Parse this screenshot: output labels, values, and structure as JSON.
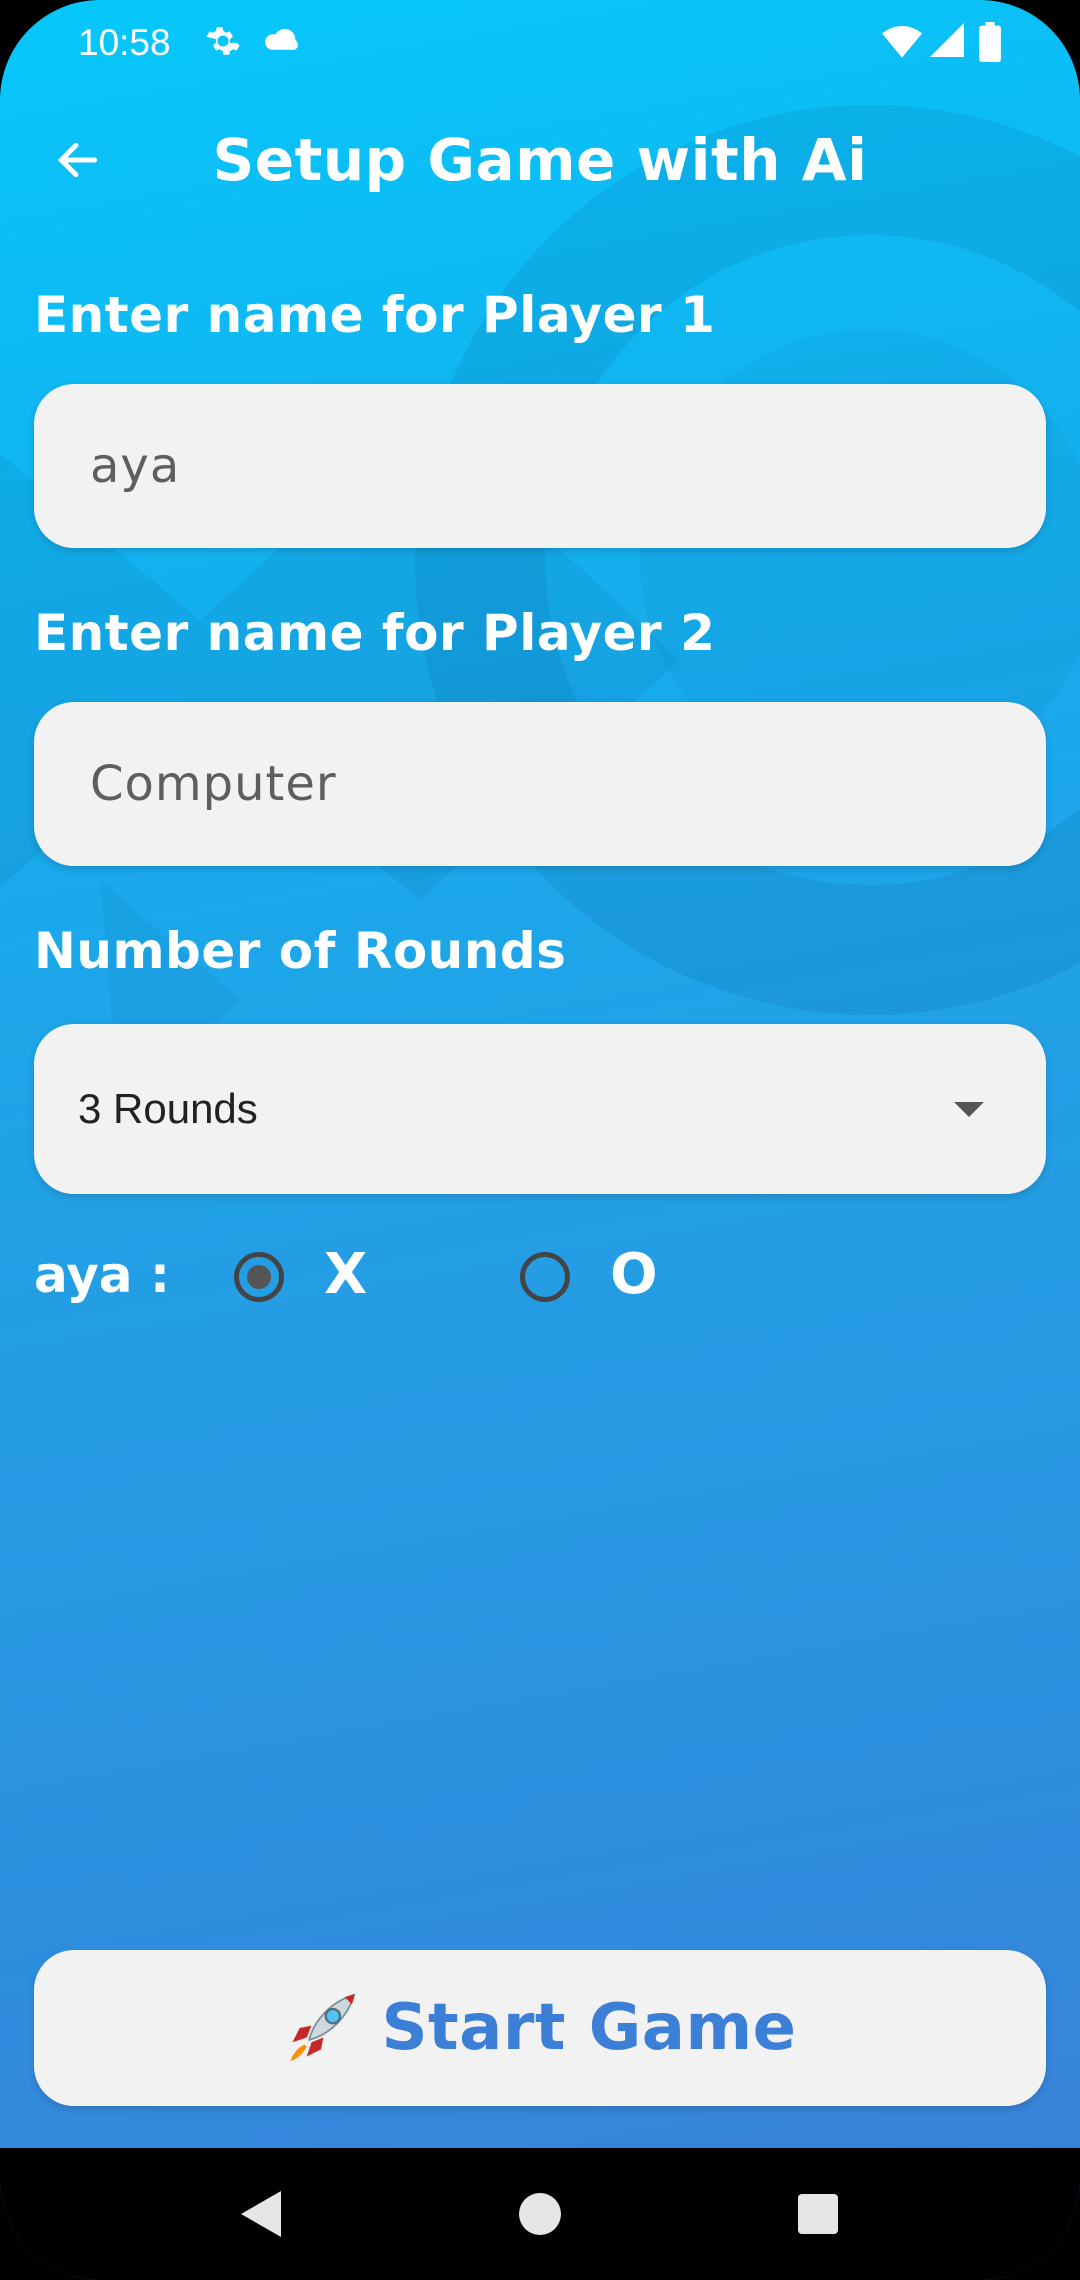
{
  "status_bar": {
    "time": "10:58",
    "icons": [
      "settings-icon",
      "cloud-icon",
      "wifi-icon",
      "signal-icon",
      "battery-icon"
    ]
  },
  "header": {
    "title": "Setup Game with Ai",
    "back_icon": "arrow-left-icon"
  },
  "form": {
    "player1_label": "Enter name for Player 1",
    "player1_value": "aya",
    "player2_label": "Enter name for Player 2",
    "player2_value": "Computer",
    "rounds_label": "Number of Rounds",
    "rounds_selected": "3 Rounds",
    "symbol_row": {
      "player_label": "aya :",
      "options": [
        {
          "label": "X",
          "selected": true
        },
        {
          "label": "O",
          "selected": false
        }
      ]
    }
  },
  "actions": {
    "start_icon": "rocket-icon",
    "start_label": "Start Game"
  },
  "nav_bar": {
    "icons": [
      "back-triangle-icon",
      "home-circle-icon",
      "recents-square-icon"
    ]
  },
  "colors": {
    "background_top": "#06c8fb",
    "background_bottom": "#3d7ed8",
    "field_bg": "#f2f2f2",
    "accent_text": "#3b7fd6"
  }
}
